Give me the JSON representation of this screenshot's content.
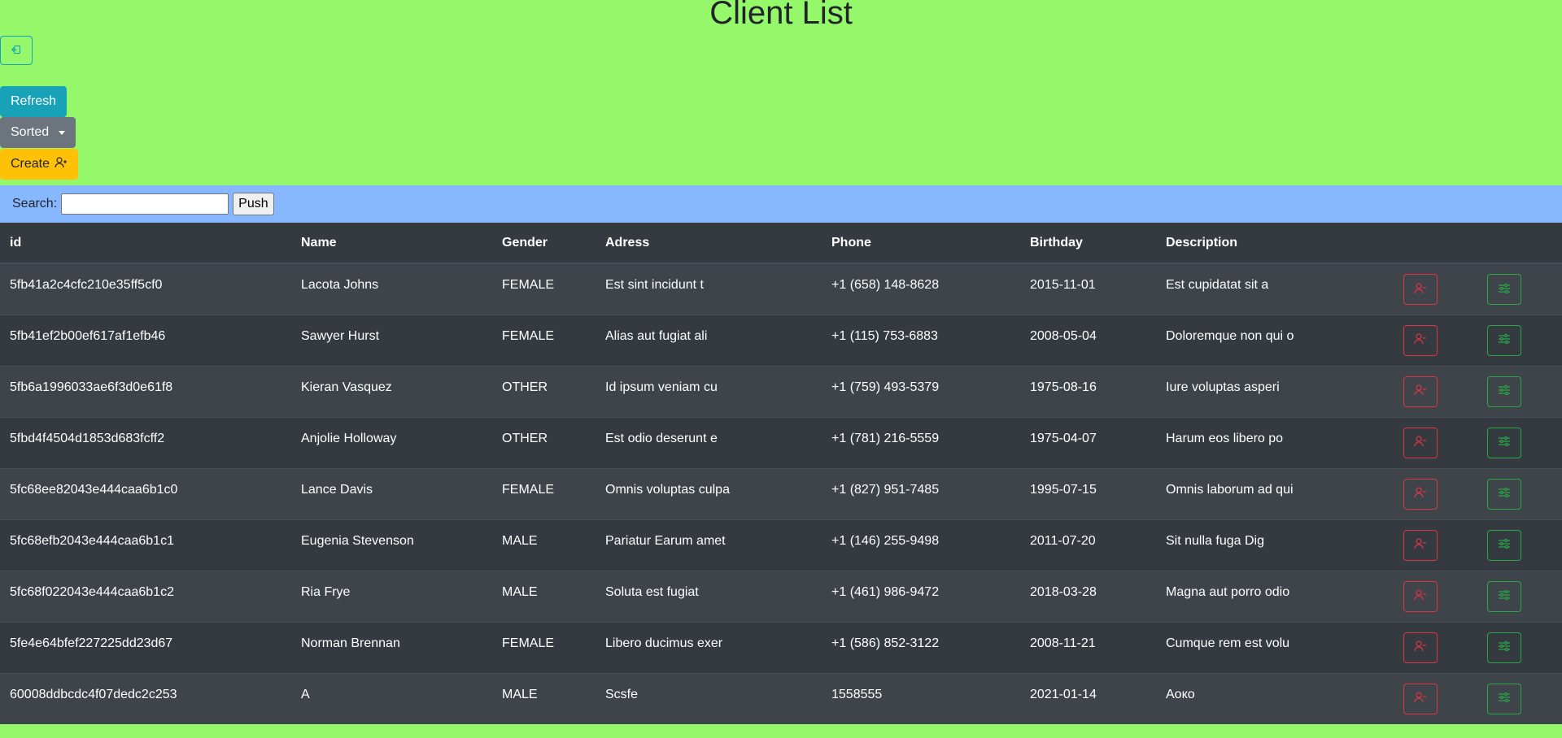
{
  "header": {
    "title": "Client List",
    "logout_icon": "box-arrow-in-left-icon",
    "refresh_label": "Refresh",
    "sorted_label": "Sorted",
    "create_label": "Create"
  },
  "search": {
    "label": "Search:",
    "value": "",
    "placeholder": "",
    "push_label": "Push"
  },
  "table": {
    "columns": [
      "id",
      "Name",
      "Gender",
      "Adress",
      "Phone",
      "Birthday",
      "Description"
    ],
    "rows": [
      {
        "id": "5fb41a2c4cfc210e35ff5cf0",
        "name": "Lacota Johns",
        "gender": "FEMALE",
        "adress": "Est sint incidunt t",
        "phone": "+1 (658) 148-8628",
        "birthday": "2015-11-01",
        "description": "Est cupidatat sit a"
      },
      {
        "id": "5fb41ef2b00ef617af1efb46",
        "name": "Sawyer Hurst",
        "gender": "FEMALE",
        "adress": "Alias aut fugiat ali",
        "phone": "+1 (115) 753-6883",
        "birthday": "2008-05-04",
        "description": "Doloremque non qui o"
      },
      {
        "id": "5fb6a1996033ae6f3d0e61f8",
        "name": "Kieran Vasquez",
        "gender": "OTHER",
        "adress": "Id ipsum veniam cu",
        "phone": "+1 (759) 493-5379",
        "birthday": "1975-08-16",
        "description": "Iure voluptas asperi"
      },
      {
        "id": "5fbd4f4504d1853d683fcff2",
        "name": "Anjolie Holloway",
        "gender": "OTHER",
        "adress": "Est odio deserunt e",
        "phone": "+1 (781) 216-5559",
        "birthday": "1975-04-07",
        "description": "Harum eos libero po"
      },
      {
        "id": "5fc68ee82043e444caa6b1c0",
        "name": "Lance Davis",
        "gender": "FEMALE",
        "adress": "Omnis voluptas culpa",
        "phone": "+1 (827) 951-7485",
        "birthday": "1995-07-15",
        "description": "Omnis laborum ad qui"
      },
      {
        "id": "5fc68efb2043e444caa6b1c1",
        "name": "Eugenia Stevenson",
        "gender": "MALE",
        "adress": "Pariatur Earum amet",
        "phone": "+1 (146) 255-9498",
        "birthday": "2011-07-20",
        "description": "Sit nulla fuga Dig"
      },
      {
        "id": "5fc68f022043e444caa6b1c2",
        "name": "Ria Frye",
        "gender": "MALE",
        "adress": "Soluta est fugiat",
        "phone": "+1 (461) 986-9472",
        "birthday": "2018-03-28",
        "description": "Magna aut porro odio"
      },
      {
        "id": "5fe4e64bfef227225dd23d67",
        "name": "Norman Brennan",
        "gender": "FEMALE",
        "adress": "Libero ducimus exer",
        "phone": "+1 (586) 852-3122",
        "birthday": "2008-11-21",
        "description": "Cumque rem est volu"
      },
      {
        "id": "60008ddbcdc4f07dedc2c253",
        "name": "A",
        "gender": "MALE",
        "adress": "Scsfe",
        "phone": "1558555",
        "birthday": "2021-01-14",
        "description": "Аоко"
      }
    ],
    "delete_icon": "person-dash-icon",
    "edit_icon": "sliders-icon"
  },
  "colors": {
    "page_bg": "#94f86a",
    "search_bg": "#87b7ff",
    "table_dark": "#343a40",
    "table_stripe": "#3e444a",
    "info": "#17a2b8",
    "secondary": "#6c757d",
    "warning": "#ffc107",
    "danger": "#dc3545",
    "success": "#28a745"
  }
}
